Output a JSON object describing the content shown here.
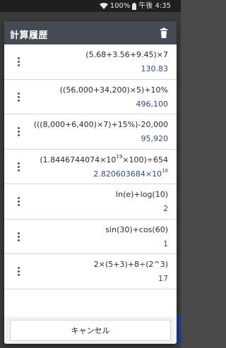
{
  "status": {
    "battery_text": "100%",
    "time": "午後 4:35"
  },
  "dialog": {
    "title": "計算履歴",
    "cancel_label": "キャンセル"
  },
  "history": [
    {
      "expr": "(5.68+3.56+9.45)×7",
      "result": "130.83"
    },
    {
      "expr": "((56,000+34,200)×5)+10%",
      "result": "496,100"
    },
    {
      "expr": "(((8,000+6,400)×7)+15%)-20,000",
      "result": "95,920"
    },
    {
      "expr_base": "(1.8446744074×10",
      "expr_exp": "19",
      "expr_tail": "×100)÷654",
      "result_base": "2.820603684×10",
      "result_exp": "18"
    },
    {
      "expr": "ln(e)+log(10)",
      "result": "2"
    },
    {
      "expr": "sin(30)+cos(60)",
      "result": "1"
    },
    {
      "expr": "2×(5+3)+8÷(2^3)",
      "result": "17"
    }
  ]
}
